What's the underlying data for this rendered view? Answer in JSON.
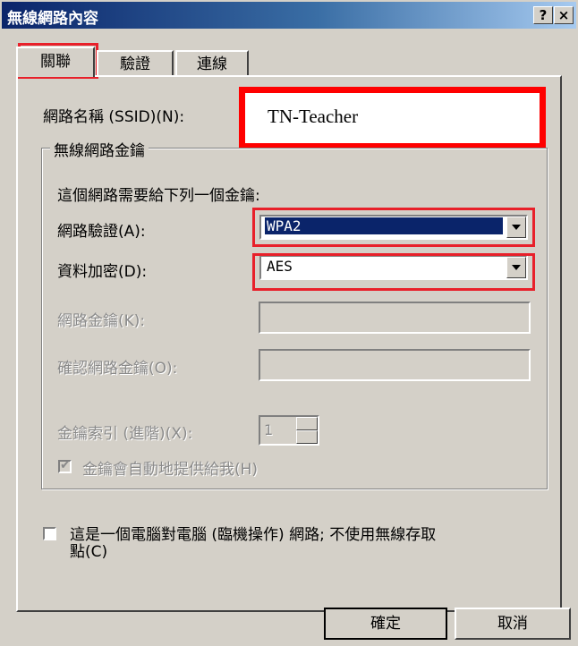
{
  "window": {
    "title": "無線網路內容",
    "help_label": "?",
    "close_label": "×"
  },
  "tabs": [
    {
      "label": "關聯",
      "selected": true
    },
    {
      "label": "驗證"
    },
    {
      "label": "連線"
    }
  ],
  "ssid": {
    "label": "網路名稱 (SSID)(N):",
    "value": "TN-Teacher"
  },
  "wireless_key_group": {
    "title": "無線網路金鑰",
    "description": "這個網路需要給下列一個金鑰:",
    "auth": {
      "label": "網路驗證(A):",
      "value": "WPA2"
    },
    "encryption": {
      "label": "資料加密(D):",
      "value": "AES"
    },
    "network_key": {
      "label": "網路金鑰(K):",
      "value": ""
    },
    "confirm_key": {
      "label": "確認網路金鑰(O):",
      "value": ""
    },
    "key_index": {
      "label": "金鑰索引 (進階)(X):",
      "value": "1"
    },
    "auto_key": {
      "label": "金鑰會自動地提供給我(H)",
      "checked": true
    }
  },
  "adhoc": {
    "label_line1": "這是一個電腦對電腦 (臨機操作) 網路; 不使用無線存取",
    "label_line2": "點(C)",
    "checked": false
  },
  "buttons": {
    "ok": "確定",
    "cancel": "取消"
  },
  "colors": {
    "highlight_red": "#e8202a",
    "selection_blue": "#0a246a",
    "dialog_face": "#d4d0c8"
  }
}
